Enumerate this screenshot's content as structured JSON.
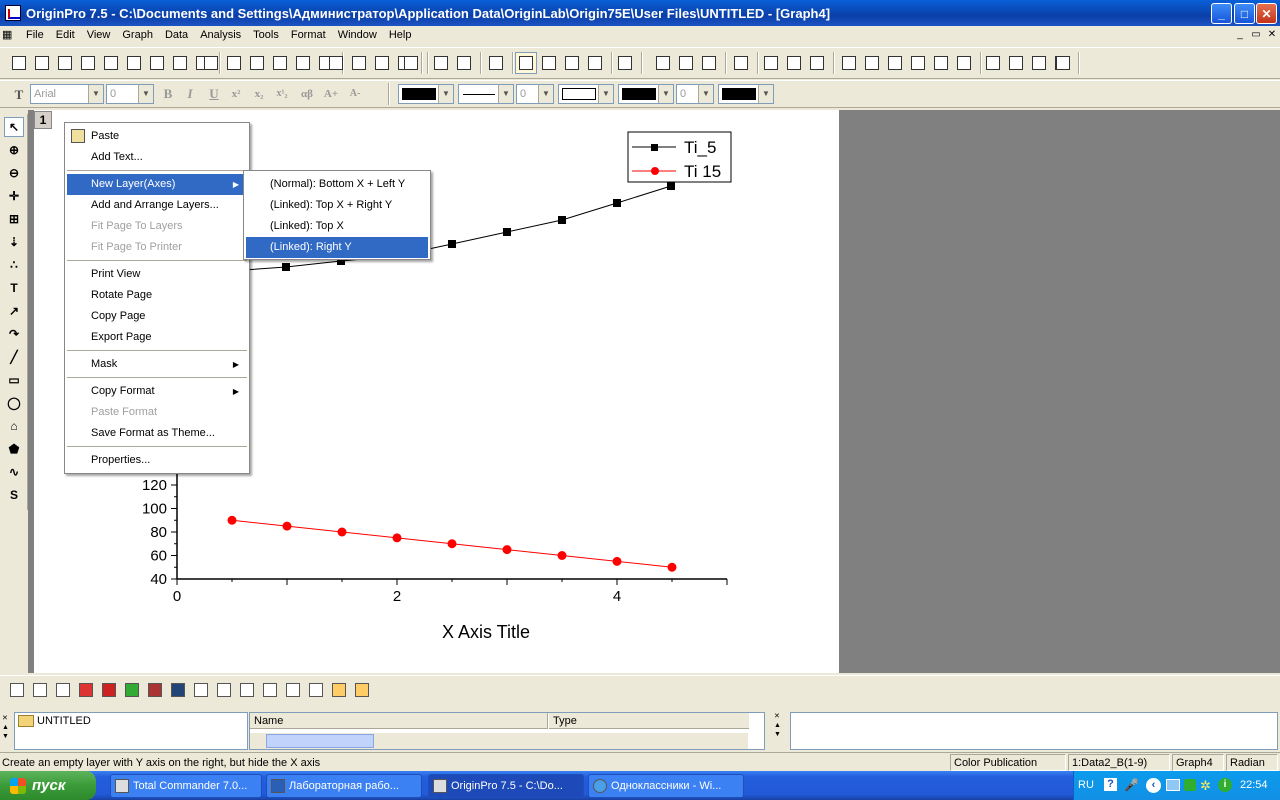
{
  "window": {
    "title": "OriginPro 7.5 - C:\\Documents and Settings\\Администратор\\Application Data\\OriginLab\\Origin75E\\User Files\\UNTITLED - [Graph4]",
    "minimize": "_",
    "maximize": "□",
    "close": "✕"
  },
  "menubar": [
    "File",
    "Edit",
    "View",
    "Graph",
    "Data",
    "Analysis",
    "Tools",
    "Format",
    "Window",
    "Help"
  ],
  "format_toolbar": {
    "font": "Arial",
    "size": "0",
    "bold": "B",
    "italic": "I",
    "underline": "U",
    "superscript": "x²",
    "subscript": "x₂",
    "supsub": "x¹₂",
    "greek": "αβ",
    "bigger": "A+",
    "smaller": "A-",
    "line_width": "0",
    "pattern_width": "0"
  },
  "layer_tab": "1",
  "context_menu": {
    "items": [
      {
        "label": "Paste",
        "enabled": true
      },
      {
        "label": "Add Text...",
        "enabled": true
      },
      {
        "label": "New Layer(Axes)",
        "enabled": true,
        "submenu": true,
        "highlighted": true
      },
      {
        "label": "Add and Arrange Layers...",
        "enabled": true
      },
      {
        "label": "Fit Page To Layers",
        "enabled": false
      },
      {
        "label": "Fit Page To Printer",
        "enabled": false
      },
      {
        "label": "Print View",
        "enabled": true
      },
      {
        "label": "Rotate Page",
        "enabled": true
      },
      {
        "label": "Copy Page",
        "enabled": true
      },
      {
        "label": "Export Page",
        "enabled": true
      },
      {
        "label": "Mask",
        "enabled": true,
        "submenu": true
      },
      {
        "label": "Copy Format",
        "enabled": true,
        "submenu": true
      },
      {
        "label": "Paste Format",
        "enabled": false
      },
      {
        "label": "Save Format as Theme...",
        "enabled": true
      },
      {
        "label": "Properties...",
        "enabled": true
      }
    ],
    "submenu_items": [
      "(Normal): Bottom X + Left Y",
      "(Linked): Top X + Right Y",
      "(Linked): Top X",
      "(Linked): Right Y"
    ]
  },
  "chart_data": {
    "type": "line",
    "xlabel": "X Axis Title",
    "xlim": [
      0,
      5
    ],
    "ylim": [
      40,
      130
    ],
    "x_ticks": [
      "0",
      "2",
      "4"
    ],
    "y_ticks": [
      "40",
      "60",
      "80",
      "100",
      "120"
    ],
    "series": [
      {
        "name": "Ti_5",
        "color": "#000000",
        "marker": "square",
        "x": [
          0.5,
          1,
          1.5,
          2,
          2.5,
          3,
          3.5,
          4,
          4.5
        ],
        "y": [
          null,
          null,
          null,
          null,
          null,
          null,
          null,
          null,
          null
        ],
        "note_visible": "upper portion above visible axis range"
      },
      {
        "name": "Ti 15",
        "color": "#ff0000",
        "marker": "circle",
        "x": [
          0.5,
          1,
          1.5,
          2,
          2.5,
          3,
          3.5,
          4,
          4.5
        ],
        "y": [
          90,
          85,
          80,
          75,
          70,
          65,
          60,
          55,
          50
        ]
      }
    ],
    "legend": {
      "position": "top-right",
      "entries": [
        "Ti_5",
        "Ti 15"
      ]
    }
  },
  "project_explorer": {
    "folder": "UNTITLED",
    "columns": [
      "Name",
      "Type"
    ]
  },
  "statusbar": {
    "message": "Create an empty layer with Y axis on the right, but hide the X axis",
    "theme": "Color Publication",
    "dataset": "1:Data2_B(1-9)",
    "window": "Graph4",
    "angle": "Radian"
  },
  "taskbar": {
    "start": "пуск",
    "tasks": [
      {
        "label": "Total Commander 7.0...",
        "active": false
      },
      {
        "label": "Лабораторная рабо...",
        "active": false
      },
      {
        "label": "OriginPro 7.5 - C:\\Do...",
        "active": true
      },
      {
        "label": "Одноклассники - Wi...",
        "active": false
      }
    ],
    "lang": "RU",
    "clock": "22:54"
  }
}
